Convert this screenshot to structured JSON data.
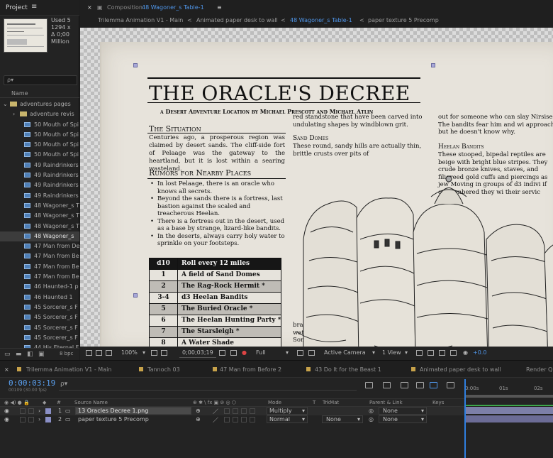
{
  "project": {
    "title": "Project",
    "menu_icon": "hamburger-icon",
    "used_info": [
      "Used 5",
      "1294 x",
      "Δ 0;00",
      "Million"
    ],
    "search_placeholder": "ρ▾",
    "column_name": "Name",
    "items": [
      {
        "label": "adventures pages",
        "type": "folder",
        "indent": 0,
        "expanded": true
      },
      {
        "label": "adventure revis",
        "type": "folder",
        "indent": 1
      },
      {
        "label": "50 Mouth of Spi",
        "type": "comp",
        "indent": 2
      },
      {
        "label": "50 Mouth of Spi",
        "type": "comp",
        "indent": 2
      },
      {
        "label": "50 Mouth of Spi",
        "type": "comp",
        "indent": 2
      },
      {
        "label": "50 Mouth of Spi",
        "type": "comp",
        "indent": 2
      },
      {
        "label": "49 Raindrinkers",
        "type": "comp",
        "indent": 2
      },
      {
        "label": "49 Raindrinkers",
        "type": "comp",
        "indent": 2
      },
      {
        "label": "49 Raindrinkers",
        "type": "comp",
        "indent": 2
      },
      {
        "label": "49 Raindrinkers",
        "type": "comp",
        "indent": 2
      },
      {
        "label": "48 Wagoner_s T",
        "type": "comp",
        "indent": 2
      },
      {
        "label": "48 Wagoner_s T",
        "type": "comp",
        "indent": 2
      },
      {
        "label": "48 Wagoner_s T",
        "type": "comp",
        "indent": 2
      },
      {
        "label": "48 Wagoner_s",
        "type": "comp",
        "indent": 2,
        "selected": true
      },
      {
        "label": "47 Man from De",
        "type": "comp",
        "indent": 2
      },
      {
        "label": "47 Man from Be",
        "type": "comp",
        "indent": 2
      },
      {
        "label": "47 Man from Be",
        "type": "comp",
        "indent": 2
      },
      {
        "label": "47 Man from Be",
        "type": "comp",
        "indent": 2
      },
      {
        "label": "46 Haunted-1 p",
        "type": "comp",
        "indent": 2
      },
      {
        "label": "46 Haunted 1",
        "type": "comp",
        "indent": 2
      },
      {
        "label": "45 Sorcerer_s F",
        "type": "comp",
        "indent": 2
      },
      {
        "label": "45 Sorcerer_s F",
        "type": "comp",
        "indent": 2
      },
      {
        "label": "45 Sorcerer_s F",
        "type": "comp",
        "indent": 2
      },
      {
        "label": "45 Sorcerer_s F",
        "type": "comp",
        "indent": 2
      },
      {
        "label": "44 His Eternal F",
        "type": "comp",
        "indent": 2
      }
    ],
    "bpc": "8 bpc"
  },
  "viewer": {
    "tab_label": "Composition 48 Wagoner_s Table-1",
    "tab_prefix": "Composition",
    "tab_comp": "48 Wagoner_s Table-1",
    "flowchart": [
      "Trilemma Animation V1 - Main",
      "Animated paper desk to wall",
      "48 Wagoner_s Table-1",
      "paper texture 5 Precomp"
    ],
    "toolbar": {
      "zoom": "100%",
      "timecode": "0;00;03;19",
      "resolution": "Full",
      "camera": "Active Camera",
      "views": "1 View",
      "exposure": "+0.0"
    }
  },
  "document": {
    "title": "THE ORACLE'S DECREE",
    "subtitle": "a Desert Adventure Location by Michael Prescott and Michael Atlin",
    "situation_heading": "The Situation",
    "situation_text": "Centuries ago, a prosperous region was claimed by desert sands. The cliff-side fort of Pelaage was the gateway to the heartland, but it is lost within a searing wasteland.",
    "rumors_heading": "Rumors for Nearby Places",
    "rumors": [
      "In lost Pelaage, there is an oracle who knows all secrets.",
      "Beyond the sands there is a fortress, last bastion against the scaled and treacherous Heelan.",
      "There is a fortress out in the desert, used as a base by strange, lizard-like bandits.",
      "In the deserts, always carry holy water to sprinkle on your footsteps."
    ],
    "table": {
      "header": [
        "d10",
        "Roll every 12 miles"
      ],
      "rows": [
        [
          "1",
          "A field of Sand Domes"
        ],
        [
          "2",
          "The Rag-Rock Hermit *"
        ],
        [
          "3-4",
          "d3 Heelan Bandits"
        ],
        [
          "5",
          "The Buried Oracle *"
        ],
        [
          "6",
          "The Heelan Hunting Party *"
        ],
        [
          "7",
          "The Starsleigh *"
        ],
        [
          "8",
          "A Water Shade"
        ]
      ]
    },
    "col2_top": "red standstone that have been carved into undulating shapes by windblown grit.",
    "dunes_heading": "Sand Domes",
    "dunes_text": "These round, sandy hills are actually thin, brittle crusts over pits of",
    "brackish_text": "brackish water. Some",
    "col3_top": "out for someone who can slay Nirsise The bandits fear him and wi approach, but he doesn't know why.",
    "bandits_heading": "Heelan Bandits",
    "bandits_text": "These stooped, bipedal reptiles are beige with bright blue stripes. They crude bronze knives, staves, and filigreed gold cuffs and piercings as jew Moving in groups of d3 indivi if outnumbered they wi their servic guides."
  },
  "timeline": {
    "tabs": [
      {
        "label": "Trilemma Animation V1 - Main",
        "color": "#c7a24a"
      },
      {
        "label": "Tannoch 03",
        "color": "#c7a24a"
      },
      {
        "label": "47 Man from Before 2",
        "color": "#c7a24a"
      },
      {
        "label": "43 Do It for the Beast 1",
        "color": "#c7a24a"
      },
      {
        "label": "Animated paper desk to wall",
        "color": "#c7a24a"
      },
      {
        "label": "Render Qu",
        "color": "#888888"
      }
    ],
    "timecode": "0:00:03:19",
    "fps": "00109 (30.00 fps)",
    "search_placeholder": "ρ▾",
    "ruler": [
      "0:00s",
      "01s",
      "02s"
    ],
    "columns": [
      "#",
      "Source Name",
      "Mode",
      "T",
      "TrkMat",
      "Parent & Link",
      "Keys"
    ],
    "layers": [
      {
        "num": "1",
        "name": "13 Oracles Decree 1.png",
        "mode": "Multiply",
        "trkmat": "",
        "parent": "None",
        "color": "#8a8fc6"
      },
      {
        "num": "2",
        "name": "paper texture 5 Precomp",
        "mode": "Normal",
        "trkmat": "None",
        "parent": "None",
        "color": "#8a8fc6"
      }
    ]
  }
}
